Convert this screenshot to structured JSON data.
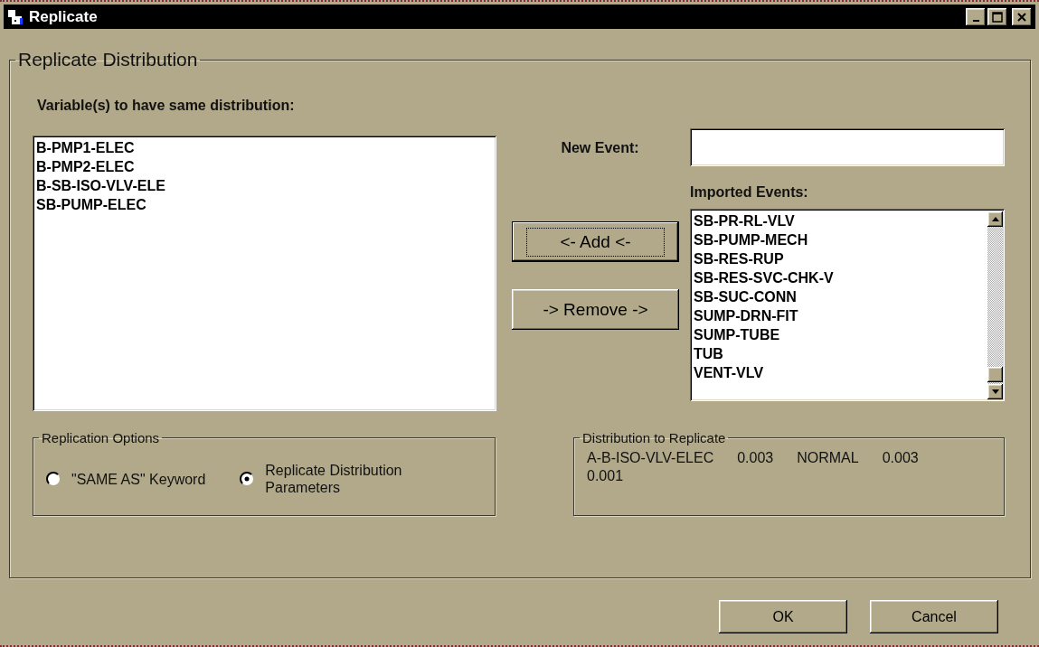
{
  "window": {
    "title": "Replicate"
  },
  "group": {
    "title": "Replicate Distribution"
  },
  "variables": {
    "label": "Variable(s) to have same distribution:",
    "items": [
      {
        "text": "B-PMP1-ELEC"
      },
      {
        "text": "B-PMP2-ELEC"
      },
      {
        "text": "B-SB-ISO-VLV-ELE"
      },
      {
        "text": "SB-PUMP-ELEC"
      }
    ]
  },
  "new_event": {
    "label": "New Event:"
  },
  "imported_events": {
    "label": "Imported Events:",
    "items": [
      {
        "text": "SB-PR-RL-VLV"
      },
      {
        "text": "SB-PUMP-MECH"
      },
      {
        "text": "SB-RES-RUP"
      },
      {
        "text": "SB-RES-SVC-CHK-V"
      },
      {
        "text": "SB-SUC-CONN"
      },
      {
        "text": "SUMP-DRN-FIT"
      },
      {
        "text": "SUMP-TUBE"
      },
      {
        "text": "TUB"
      },
      {
        "text": "VENT-VLV"
      }
    ]
  },
  "transfer_buttons": [
    {
      "label": "<- Add <-",
      "default": true
    },
    {
      "label": "-> Remove ->",
      "default": false
    }
  ],
  "replication_options": {
    "title": "Replication Options",
    "options": [
      {
        "label": "\"SAME AS\" Keyword",
        "selected": false
      },
      {
        "label": "Replicate Distribution Parameters",
        "selected": true
      }
    ]
  },
  "distribution": {
    "title": "Distribution to Replicate",
    "values": [
      "A-B-ISO-VLV-ELEC",
      "0.003",
      "NORMAL",
      "0.003",
      "0.001"
    ]
  },
  "dialog_buttons": [
    {
      "label": "OK"
    },
    {
      "label": "Cancel"
    }
  ]
}
